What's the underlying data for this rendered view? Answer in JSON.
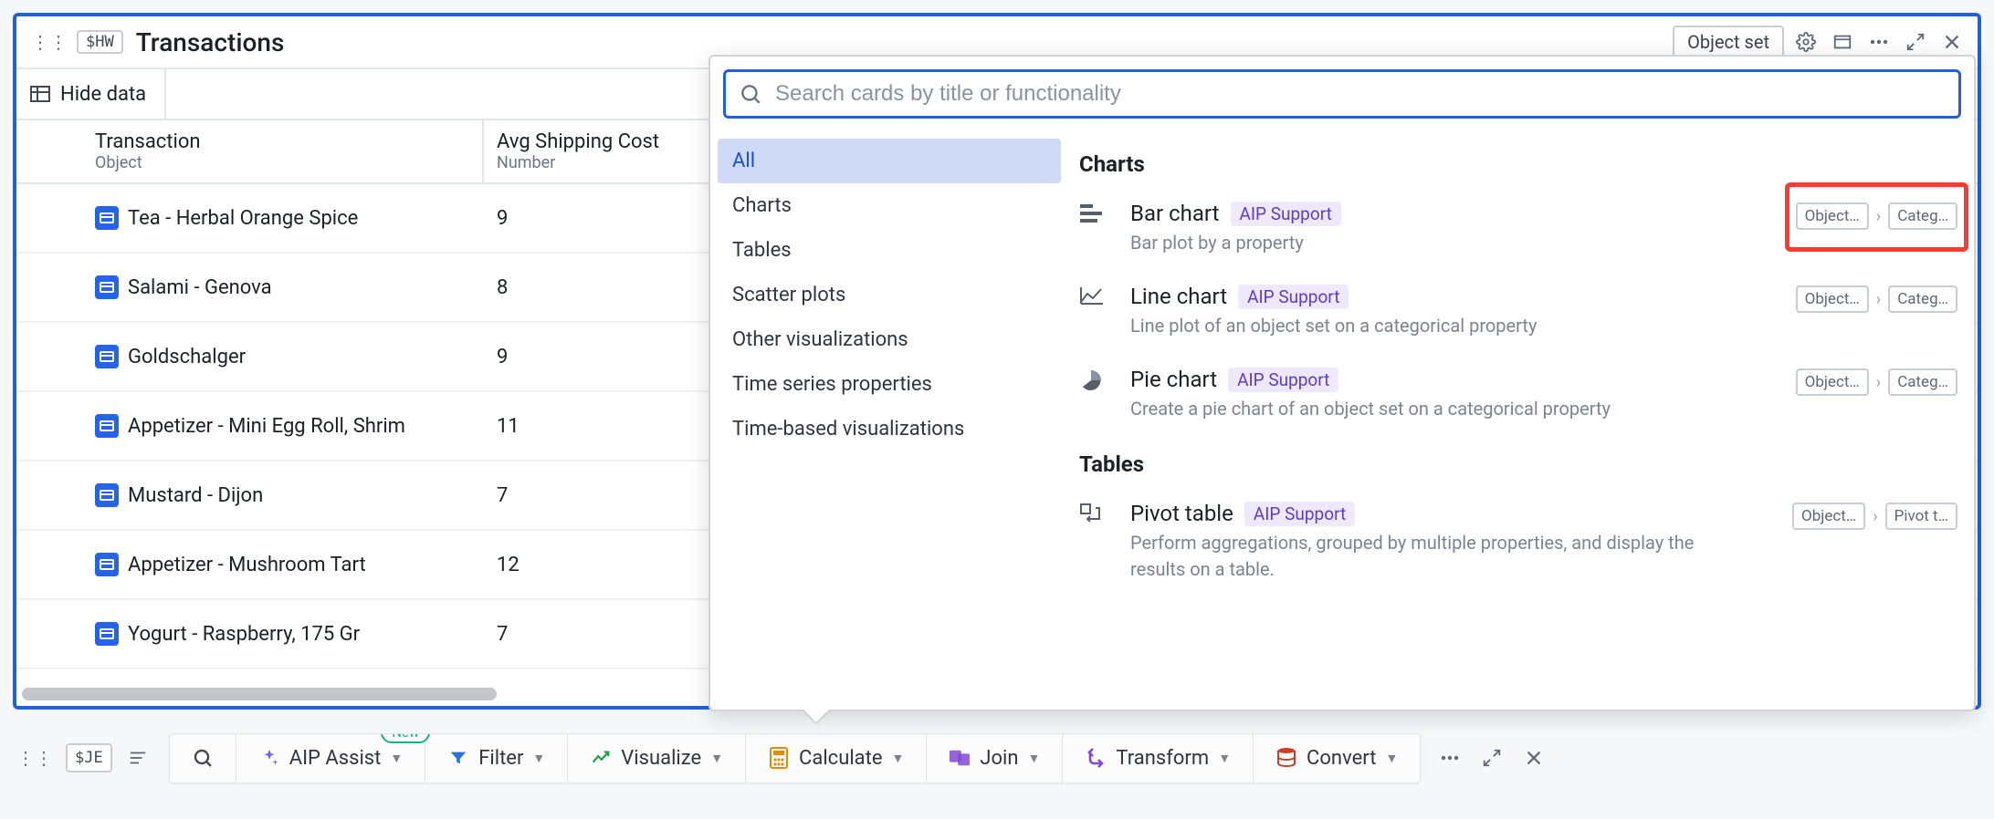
{
  "card": {
    "badge": "$HW",
    "title": "Transactions",
    "object_set_label": "Object set",
    "hide_data_label": "Hide data"
  },
  "columns": [
    {
      "primary": "Transaction",
      "secondary": "Object"
    },
    {
      "primary": "Avg Shipping Cost",
      "secondary": "Number"
    }
  ],
  "rows": [
    {
      "name": "Tea - Herbal Orange Spice",
      "cost": "9"
    },
    {
      "name": "Salami - Genova",
      "cost": "8"
    },
    {
      "name": "Goldschalger",
      "cost": "9"
    },
    {
      "name": "Appetizer - Mini Egg Roll, Shrim",
      "cost": "11"
    },
    {
      "name": "Mustard - Dijon",
      "cost": "7"
    },
    {
      "name": "Appetizer - Mushroom Tart",
      "cost": "12"
    },
    {
      "name": "Yogurt - Raspberry, 175 Gr",
      "cost": "7"
    }
  ],
  "popover": {
    "search_placeholder": "Search cards by title or functionality",
    "categories": [
      {
        "label": "All",
        "selected": true
      },
      {
        "label": "Charts"
      },
      {
        "label": "Tables"
      },
      {
        "label": "Scatter plots"
      },
      {
        "label": "Other visualizations"
      },
      {
        "label": "Time series properties"
      },
      {
        "label": "Time-based visualizations"
      }
    ],
    "groups": [
      {
        "heading": "Charts",
        "items": [
          {
            "icon": "bar",
            "title": "Bar chart",
            "pill": "AIP Support",
            "desc": "Bar plot by a property",
            "tags": [
              "Object…",
              "Categ…"
            ],
            "highlight": true
          },
          {
            "icon": "line",
            "title": "Line chart",
            "pill": "AIP Support",
            "desc": "Line plot of an object set on a categorical property",
            "tags": [
              "Object…",
              "Categ…"
            ]
          },
          {
            "icon": "pie",
            "title": "Pie chart",
            "pill": "AIP Support",
            "desc": "Create a pie chart of an object set on a categorical property",
            "tags": [
              "Object…",
              "Categ…"
            ]
          }
        ]
      },
      {
        "heading": "Tables",
        "items": [
          {
            "icon": "pivot",
            "title": "Pivot table",
            "pill": "AIP Support",
            "desc": "Perform aggregations, grouped by multiple properties, and display the results on a table.",
            "tags": [
              "Object…",
              "Pivot t…"
            ]
          }
        ]
      }
    ]
  },
  "toolbar": {
    "left_badge": "$JE",
    "actions": [
      {
        "key": "search",
        "label": "",
        "icon": "search"
      },
      {
        "key": "aip",
        "label": "AIP Assist",
        "icon": "sparkle",
        "new": true,
        "caret": true
      },
      {
        "key": "filter",
        "label": "Filter",
        "icon": "filter",
        "caret": true
      },
      {
        "key": "visualize",
        "label": "Visualize",
        "icon": "chart",
        "caret": true
      },
      {
        "key": "calculate",
        "label": "Calculate",
        "icon": "calc",
        "caret": true
      },
      {
        "key": "join",
        "label": "Join",
        "icon": "join",
        "caret": true
      },
      {
        "key": "transform",
        "label": "Transform",
        "icon": "transform",
        "caret": true
      },
      {
        "key": "convert",
        "label": "Convert",
        "icon": "db",
        "caret": true
      }
    ],
    "new_label": "New"
  }
}
